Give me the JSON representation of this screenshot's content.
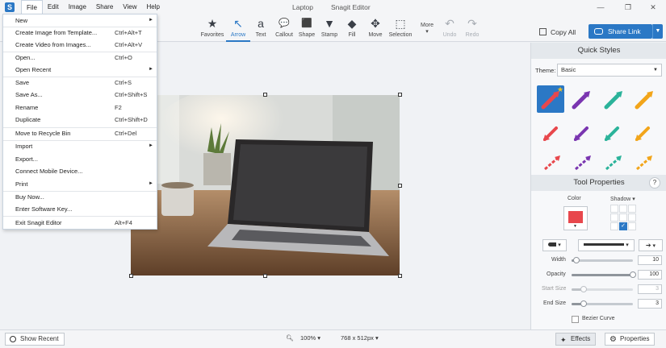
{
  "titlebar": {
    "app_icon": "S",
    "menu": [
      "File",
      "Edit",
      "Image",
      "Share",
      "View",
      "Help"
    ],
    "doc_title": "Laptop",
    "app_title": "Snagit Editor",
    "controls": {
      "minimize": "—",
      "restore": "❐",
      "close": "✕"
    }
  },
  "toolbar": {
    "tools": [
      {
        "label": "Favorites",
        "icon": "★"
      },
      {
        "label": "Arrow",
        "icon": "↖"
      },
      {
        "label": "Text",
        "icon": "a"
      },
      {
        "label": "Callout",
        "icon": "💬"
      },
      {
        "label": "Shape",
        "icon": "⬛"
      },
      {
        "label": "Stamp",
        "icon": "▼"
      },
      {
        "label": "Fill",
        "icon": "◆"
      },
      {
        "label": "Move",
        "icon": "✥"
      },
      {
        "label": "Selection",
        "icon": "⬚"
      },
      {
        "label": "More",
        "icon": "▾"
      },
      {
        "label": "Undo",
        "icon": "↶"
      },
      {
        "label": "Redo",
        "icon": "↷"
      }
    ],
    "copy_all": "Copy All",
    "share_link": "Share Link",
    "accent": "#2b78c5"
  },
  "file_menu": {
    "items": [
      {
        "label": "New",
        "shortcut": "",
        "arrow": "►"
      },
      {
        "label": "Create Image from Template...",
        "shortcut": "Ctrl+Alt+T",
        "arrow": ""
      },
      {
        "label": "Create Video from Images...",
        "shortcut": "Ctrl+Alt+V",
        "arrow": ""
      },
      {
        "label": "Open...",
        "shortcut": "Ctrl+O",
        "arrow": ""
      },
      {
        "label": "Open Recent",
        "shortcut": "",
        "arrow": "►"
      },
      {
        "label": "Save",
        "shortcut": "Ctrl+S",
        "arrow": ""
      },
      {
        "label": "Save As...",
        "shortcut": "Ctrl+Shift+S",
        "arrow": ""
      },
      {
        "label": "Rename",
        "shortcut": "F2",
        "arrow": ""
      },
      {
        "label": "Duplicate",
        "shortcut": "Ctrl+Shift+D",
        "arrow": ""
      },
      {
        "label": "Move to Recycle Bin",
        "shortcut": "Ctrl+Del",
        "arrow": ""
      },
      {
        "label": "Import",
        "shortcut": "",
        "arrow": "►"
      },
      {
        "label": "Export...",
        "shortcut": "",
        "arrow": ""
      },
      {
        "label": "Connect Mobile Device...",
        "shortcut": "",
        "arrow": ""
      },
      {
        "label": "Print",
        "shortcut": "",
        "arrow": "►"
      },
      {
        "label": "Buy Now...",
        "shortcut": "",
        "arrow": ""
      },
      {
        "label": "Enter Software Key...",
        "shortcut": "",
        "arrow": ""
      },
      {
        "label": "Exit Snagit Editor",
        "shortcut": "Alt+F4",
        "arrow": ""
      }
    ]
  },
  "panel": {
    "quick_styles": "Quick Styles",
    "theme_label": "Theme:",
    "theme_value": "Basic",
    "theme_dropdown": "▼",
    "tool_properties": "Tool Properties",
    "help": "?",
    "color_label": "Color",
    "shadow_label": "Shadow ▾",
    "shadow_check": "✓",
    "style_colors": [
      "#e8474c",
      "#7a35b0",
      "#2bb39a",
      "#f2a51a"
    ],
    "selected_color": "#e8474c",
    "props": [
      {
        "label": "Width",
        "value": "10",
        "disabled": false,
        "level": 0.08
      },
      {
        "label": "Opacity",
        "value": "100",
        "disabled": false,
        "level": 1.0
      },
      {
        "label": "Start Size",
        "value": "3",
        "disabled": true,
        "level": 0.2
      },
      {
        "label": "End Size",
        "value": "3",
        "disabled": false,
        "level": 0.2
      }
    ],
    "bezier": "Bezier Curve"
  },
  "statusbar": {
    "show_recent": "Show Recent",
    "zoom": "100% ▾",
    "dimensions": "768 x 512px ▾",
    "effects": "Effects",
    "properties": "Properties"
  }
}
